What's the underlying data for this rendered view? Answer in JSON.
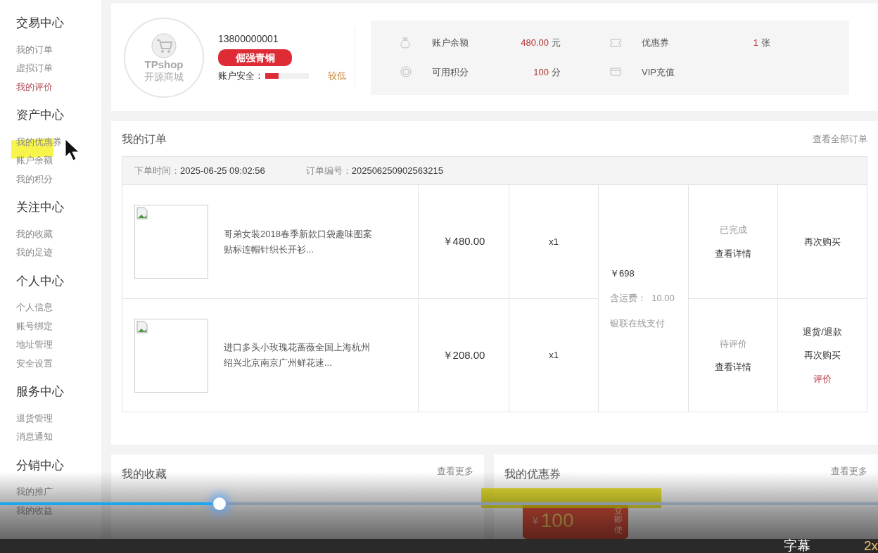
{
  "sidebar": {
    "groups": [
      {
        "title": "交易中心",
        "items": [
          {
            "label": "我的订单",
            "selected": false
          },
          {
            "label": "虚拟订单",
            "selected": false
          },
          {
            "label": "我的评价",
            "selected": true
          }
        ]
      },
      {
        "title": "资产中心",
        "items": [
          {
            "label": "我的优惠券",
            "selected": false
          },
          {
            "label": "账户余额",
            "selected": false
          },
          {
            "label": "我的积分",
            "selected": false
          }
        ]
      },
      {
        "title": "关注中心",
        "items": [
          {
            "label": "我的收藏",
            "selected": false
          },
          {
            "label": "我的足迹",
            "selected": false
          }
        ]
      },
      {
        "title": "个人中心",
        "items": [
          {
            "label": "个人信息",
            "selected": false
          },
          {
            "label": "账号绑定",
            "selected": false
          },
          {
            "label": "地址管理",
            "selected": false
          },
          {
            "label": "安全设置",
            "selected": false
          }
        ]
      },
      {
        "title": "服务中心",
        "items": [
          {
            "label": "退货管理",
            "selected": false
          },
          {
            "label": "消息通知",
            "selected": false
          }
        ]
      },
      {
        "title": "分销中心",
        "items": [
          {
            "label": "我的推广",
            "selected": false
          },
          {
            "label": "我的收益",
            "selected": false
          }
        ]
      }
    ]
  },
  "profile": {
    "avatar_brand": "TPshop",
    "avatar_sub": "开源商城",
    "phone": "13800000001",
    "rank": "倔强青铜",
    "security_label": "账户安全：",
    "security": {
      "level": 0.3
    },
    "security_text": "较低"
  },
  "assets": [
    {
      "kind": "wallet",
      "label": "账户余额",
      "value": "480.00",
      "unit": "元"
    },
    {
      "kind": "ticket",
      "label": "优惠券",
      "value": "1",
      "unit": "张"
    },
    {
      "kind": "coin",
      "label": "可用积分",
      "value": "100",
      "unit": "分"
    },
    {
      "kind": "card",
      "label": "VIP充值"
    }
  ],
  "orders": {
    "title": "我的订单",
    "more": "查看全部订单",
    "order": {
      "time_label": "下单时间：",
      "time": "2025-06-25 09:02:56",
      "no_label": "订单编号：",
      "no": "20250625090256321​5",
      "total": "￥698",
      "shipping": "含运费：  10.00",
      "payment": "银联在线支付",
      "items": [
        {
          "name": "哥弟女装2018春季新款口袋趣味图案贴标连帽针织长开衫...",
          "price": "￥480.00",
          "qty": "x1",
          "status": "已完成",
          "detail": "查看详情",
          "actions": [
            {
              "label": "再次购买",
              "kind": "normal"
            }
          ]
        },
        {
          "name": "进口多头小玫瑰花蔷薇全国上海杭州绍兴北京南京广州鲜花速...",
          "price": "￥208.00",
          "qty": "x1",
          "status": "待评价",
          "detail": "查看详情",
          "actions": [
            {
              "label": "退货/退款",
              "kind": "normal"
            },
            {
              "label": "再次购买",
              "kind": "normal"
            },
            {
              "label": "评价",
              "kind": "accent"
            }
          ]
        }
      ]
    }
  },
  "favorites": {
    "title": "我的收藏",
    "more": "查看更多"
  },
  "coupons": {
    "title": "我的优惠券",
    "more": "查看更多",
    "coupon": {
      "currency": "¥",
      "amount": "100",
      "action": "立即使"
    }
  },
  "player": {
    "progress": {
      "level": 0.25
    },
    "subtitle": "字幕",
    "speed": "2x"
  }
}
